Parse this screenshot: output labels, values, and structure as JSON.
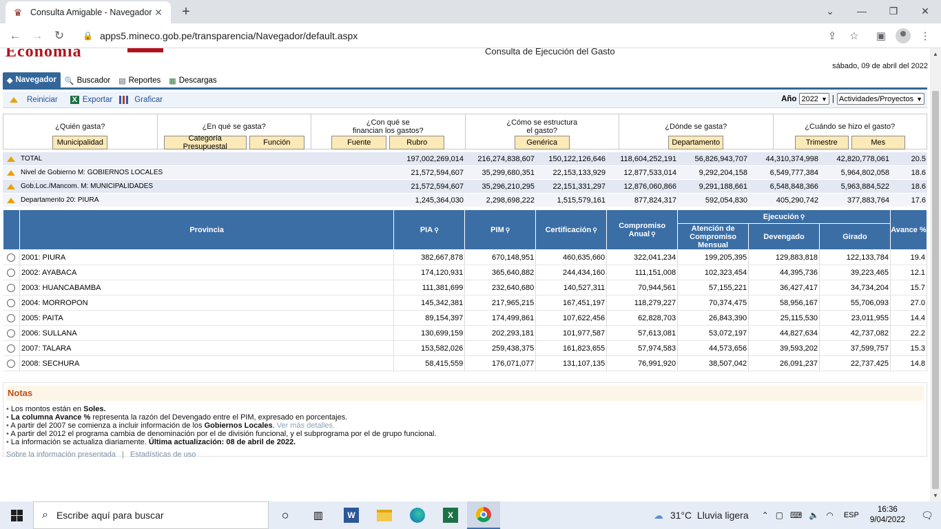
{
  "browser": {
    "tab_title": "Consulta Amigable - Navegador",
    "url": "apps5.mineco.gob.pe/transparencia/Navegador/default.aspx"
  },
  "header": {
    "logo_text": "Economía",
    "page_title": "Consulta de Ejecución del Gasto",
    "date": "sábado, 09 de abril del 2022"
  },
  "menu": [
    {
      "label": "Navegador",
      "active": true
    },
    {
      "label": "Buscador"
    },
    {
      "label": "Reportes"
    },
    {
      "label": "Descargas"
    }
  ],
  "actions": {
    "reiniciar": "Reiniciar",
    "exportar": "Exportar",
    "graficar": "Graficar",
    "year_label": "Año",
    "year_value": "2022",
    "mode_value": "Actividades/Proyectos"
  },
  "questions": [
    {
      "text": "¿Quién gasta?",
      "buttons": [
        "Municipalidad"
      ]
    },
    {
      "text": "¿En qué se gasta?",
      "buttons": [
        "Categoría Presupuestal",
        "Función"
      ]
    },
    {
      "text": "¿Con qué se\nfinancian los gastos?",
      "buttons": [
        "Fuente",
        "Rubro"
      ]
    },
    {
      "text": "¿Cómo se estructura\nel gasto?",
      "buttons": [
        "Genérica"
      ]
    },
    {
      "text": "¿Dónde se gasta?",
      "buttons": [
        "Departamento"
      ]
    },
    {
      "text": "¿Cuándo se hizo el gasto?",
      "buttons": [
        "Trimestre",
        "Mes"
      ]
    }
  ],
  "summary": [
    {
      "label": "TOTAL",
      "values": [
        "197,002,269,014",
        "216,274,838,607",
        "150,122,126,646",
        "118,604,252,191",
        "56,826,943,707",
        "44,310,374,998",
        "42,820,778,061",
        "20.5"
      ]
    },
    {
      "label": "Nivel de Gobierno M: GOBIERNOS LOCALES",
      "values": [
        "21,572,594,607",
        "35,299,680,351",
        "22,153,133,929",
        "12,877,533,014",
        "9,292,204,158",
        "6,549,777,384",
        "5,964,802,058",
        "18.6"
      ]
    },
    {
      "label": "Gob.Loc./Mancom. M: MUNICIPALIDADES",
      "values": [
        "21,572,594,607",
        "35,296,210,295",
        "22,151,331,297",
        "12,876,060,866",
        "9,291,188,661",
        "6,548,848,366",
        "5,963,884,522",
        "18.6"
      ]
    },
    {
      "label": "Departamento 20: PIURA",
      "values": [
        "1,245,364,030",
        "2,298,698,222",
        "1,515,579,161",
        "877,824,317",
        "592,054,830",
        "405,290,742",
        "377,883,764",
        "17.6"
      ]
    }
  ],
  "table": {
    "headers": {
      "provincia": "Provincia",
      "pia": "PIA",
      "pim": "PIM",
      "certificacion": "Certificación",
      "compromiso_anual": "Compromiso Anual",
      "ejecucion": "Ejecución",
      "atencion": "Atención de Compromiso Mensual",
      "devengado": "Devengado",
      "girado": "Girado",
      "avance": "Avance %"
    },
    "rows": [
      {
        "name": "2001: PIURA",
        "values": [
          "382,667,878",
          "670,148,951",
          "460,635,660",
          "322,041,234",
          "199,205,395",
          "129,883,818",
          "122,133,784",
          "19.4"
        ]
      },
      {
        "name": "2002: AYABACA",
        "values": [
          "174,120,931",
          "365,640,882",
          "244,434,160",
          "111,151,008",
          "102,323,454",
          "44,395,736",
          "39,223,465",
          "12.1"
        ]
      },
      {
        "name": "2003: HUANCABAMBA",
        "values": [
          "111,381,699",
          "232,640,680",
          "140,527,311",
          "70,944,561",
          "57,155,221",
          "36,427,417",
          "34,734,204",
          "15.7"
        ]
      },
      {
        "name": "2004: MORROPON",
        "values": [
          "145,342,381",
          "217,965,215",
          "167,451,197",
          "118,279,227",
          "70,374,475",
          "58,956,167",
          "55,706,093",
          "27.0"
        ]
      },
      {
        "name": "2005: PAITA",
        "values": [
          "89,154,397",
          "174,499,861",
          "107,622,456",
          "62,828,703",
          "26,843,390",
          "25,115,530",
          "23,011,955",
          "14.4"
        ]
      },
      {
        "name": "2006: SULLANA",
        "values": [
          "130,699,159",
          "202,293,181",
          "101,977,587",
          "57,613,081",
          "53,072,197",
          "44,827,634",
          "42,737,082",
          "22.2"
        ]
      },
      {
        "name": "2007: TALARA",
        "values": [
          "153,582,026",
          "259,438,375",
          "161,823,655",
          "57,974,583",
          "44,573,656",
          "39,593,202",
          "37,599,757",
          "15.3"
        ]
      },
      {
        "name": "2008: SECHURA",
        "values": [
          "58,415,559",
          "176,071,077",
          "131,107,135",
          "76,991,920",
          "38,507,042",
          "26,091,237",
          "22,737,425",
          "14.8"
        ]
      }
    ]
  },
  "notes": {
    "title": "Notas",
    "items": [
      {
        "pre": "Los montos están en ",
        "bold": "Soles.",
        "post": ""
      },
      {
        "pre": "",
        "bold": "La columna Avance %",
        "post": " representa la razón del Devengado entre el PIM, expresado en porcentajes."
      },
      {
        "pre": "A partir del 2007 se comienza a incluir información de los ",
        "bold": "Gobiernos Locales",
        "post": ".",
        "link": " Ver más detalles."
      },
      {
        "pre": "A partir del 2012 el programa cambia de denominación por el de división funcional, y el subprograma por el de grupo funcional.",
        "bold": "",
        "post": ""
      },
      {
        "pre": "La información se actualiza diariamente. ",
        "bold": "Última actualización: 08 de abril de 2022.",
        "post": ""
      }
    ],
    "link1": "Sobre la información presentada",
    "separator": "|",
    "link2": "Estadísticas de uso"
  },
  "taskbar": {
    "search_placeholder": "Escribe aquí para buscar",
    "weather": "31°C  Lluvia ligera",
    "lang": "ESP",
    "time": "16:36",
    "date": "9/04/2022"
  }
}
